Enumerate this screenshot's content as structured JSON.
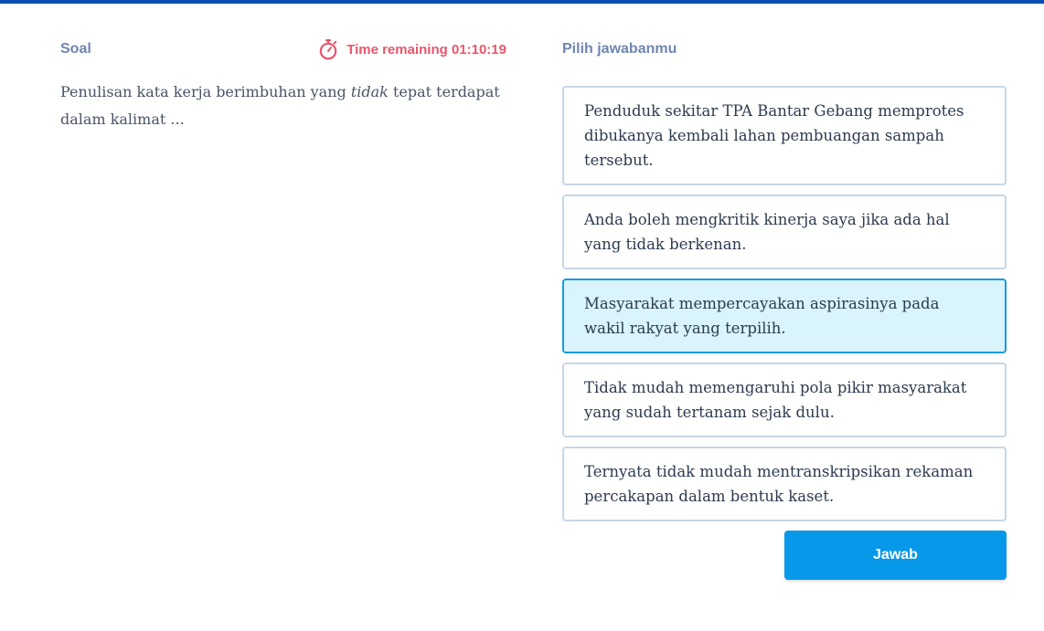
{
  "left": {
    "section_label": "Soal",
    "timer_text": "Time remaining 01:10:19",
    "question_before": "Penulisan kata kerja berimbuhan yang ",
    "question_emphasis": "tidak",
    "question_after": " tepat terdapat dalam kalimat ..."
  },
  "right": {
    "section_label": "Pilih jawabanmu",
    "options": [
      {
        "text": "Penduduk sekitar TPA Bantar Gebang memprotes dibukanya kembali lahan pembuangan sampah tersebut."
      },
      {
        "text": "Anda boleh mengkritik kinerja saya jika ada hal yang tidak berkenan."
      },
      {
        "text": "Masyarakat mempercayakan aspirasinya pada wakil rakyat yang terpilih."
      },
      {
        "text": "Tidak mudah memengaruhi pola pikir masyarakat yang sudah tertanam sejak dulu."
      },
      {
        "text": "Ternyata tidak mudah mentranskripsikan rekaman percakapan dalam bentuk kaset."
      }
    ],
    "selected_index": 2,
    "submit_label": "Jawab"
  },
  "icons": {
    "timer": "stopwatch-icon"
  },
  "colors": {
    "accent": "#0798ea",
    "timer": "#e8566b",
    "label": "#6f86b0",
    "selected_bg": "#d9f4fc",
    "selected_border": "#1a9be0",
    "top_bar": "#0a4fb0"
  }
}
